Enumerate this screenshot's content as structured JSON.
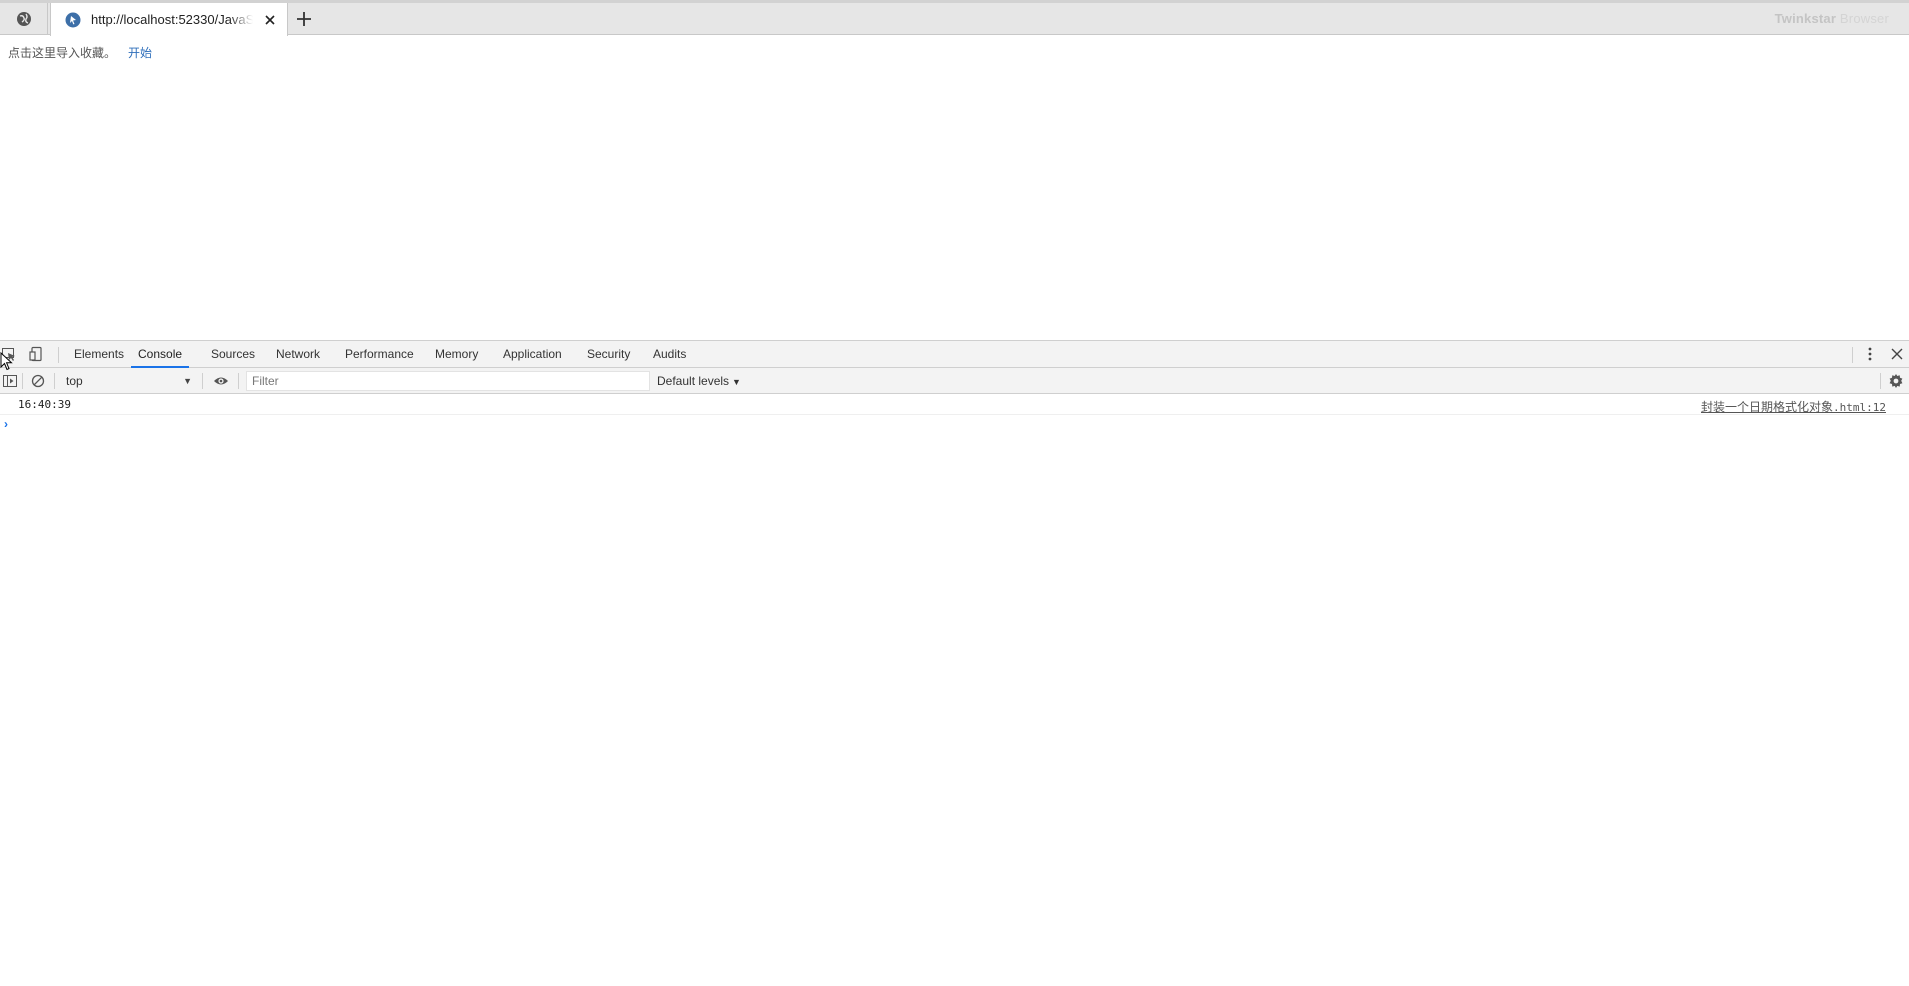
{
  "browser": {
    "tab": {
      "title": "http://localhost:52330/JavaScript/",
      "close_icon": "close-icon"
    },
    "brand": {
      "bold": "Twinkstar",
      "light": " Browser"
    },
    "bookmarks": {
      "prompt": "点击这里导入收藏。",
      "link": "开始"
    }
  },
  "devtools": {
    "tabs": [
      {
        "label": "Elements"
      },
      {
        "label": "Console"
      },
      {
        "label": "Sources"
      },
      {
        "label": "Network"
      },
      {
        "label": "Performance"
      },
      {
        "label": "Memory"
      },
      {
        "label": "Application"
      },
      {
        "label": "Security"
      },
      {
        "label": "Audits"
      }
    ],
    "active_tab": "Console",
    "accent_color": "#1a73e8",
    "console": {
      "context": "top",
      "filter_placeholder": "Filter",
      "levels": "Default levels",
      "messages": [
        {
          "text": "16:40:39",
          "source_name": "封装一个日期格式化对象",
          "source_file": ".html:12"
        }
      ]
    }
  }
}
